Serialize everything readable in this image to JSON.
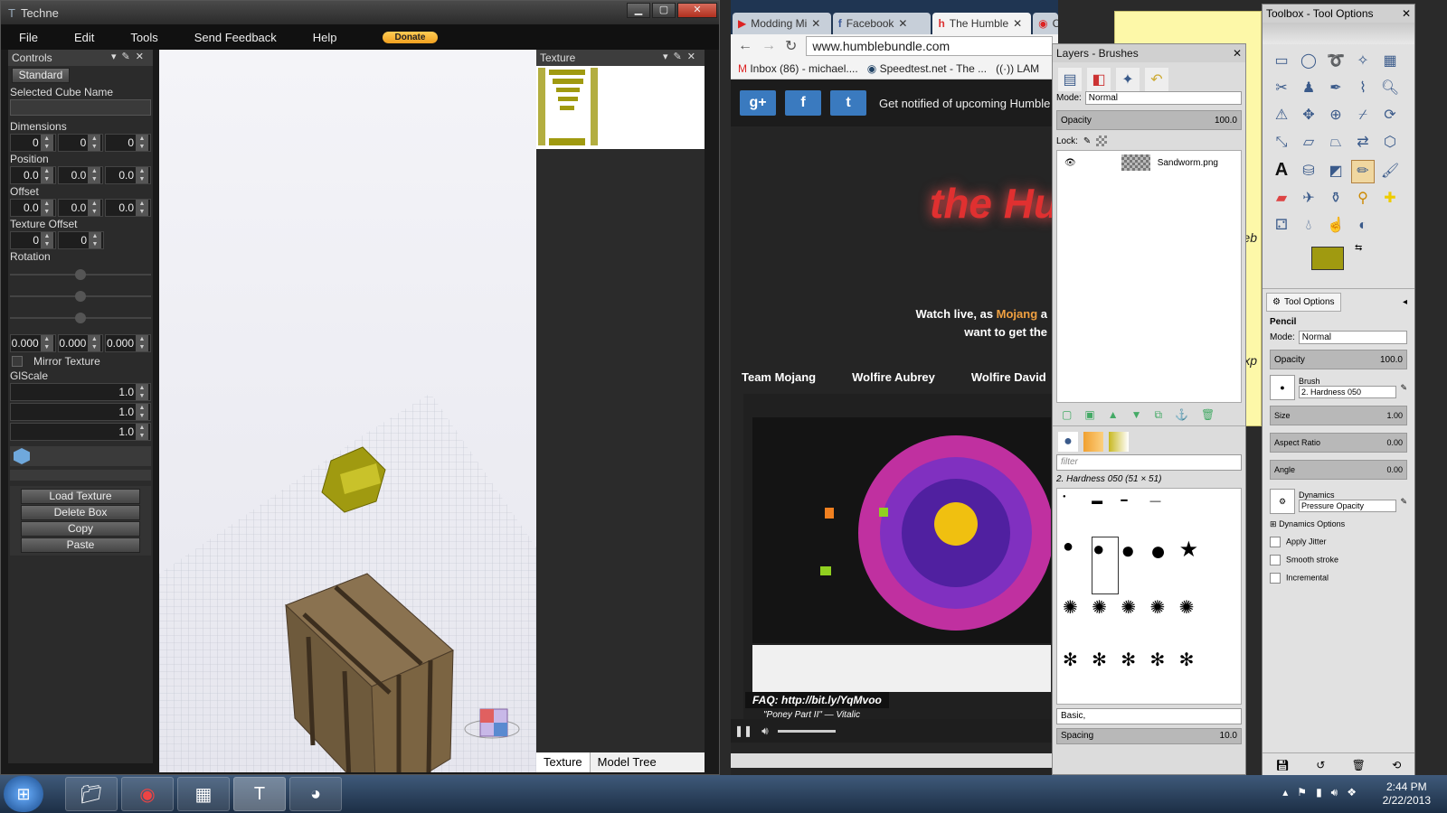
{
  "techne": {
    "title": "Techne",
    "menu": [
      "File",
      "Edit",
      "Tools",
      "Send Feedback",
      "Help"
    ],
    "donate": "Donate",
    "controls": {
      "header": "Controls",
      "standard_btn": "Standard",
      "selected_cube_label": "Selected Cube Name",
      "dimensions_label": "Dimensions",
      "dimensions": [
        "0",
        "0",
        "0"
      ],
      "position_label": "Position",
      "position": [
        "0.0",
        "0.0",
        "0.0"
      ],
      "offset_label": "Offset",
      "offset": [
        "0.0",
        "0.0",
        "0.0"
      ],
      "texture_offset_label": "Texture Offset",
      "texture_offset": [
        "0",
        "0"
      ],
      "rotation_label": "Rotation",
      "rotation": [
        "0.000",
        "0.000",
        "0.000"
      ],
      "mirror_label": "Mirror Texture",
      "glscale_label": "GlScale",
      "glscale": [
        "1.0",
        "1.0",
        "1.0"
      ],
      "load_texture": "Load Texture",
      "delete_box": "Delete Box",
      "copy": "Copy",
      "paste": "Paste"
    },
    "texture_panel": {
      "header": "Texture",
      "tab_texture": "Texture",
      "tab_model_tree": "Model Tree"
    }
  },
  "chrome": {
    "tabs": [
      "Modding Mi",
      "Facebook",
      "The Humble",
      "C"
    ],
    "url": "www.humblebundle.com",
    "bookmarks": [
      "Inbox (86) - michael....",
      "Speedtest.net - The ...",
      "LAM"
    ],
    "banner_text": "Get notified of upcoming Humble B",
    "logo": "the Hum",
    "watch_live_pre": "Watch live, as ",
    "watch_live_mojang": "Mojang",
    "watch_live_post": " a",
    "want_line": "want to get the",
    "teams": [
      "Team Mojang",
      "Wolfire Aubrey",
      "Wolfire David"
    ],
    "faq": "FAQ: http://bit.ly/YqMvoo",
    "song": "\"Poney Part II\" — Vitalic"
  },
  "layers": {
    "title": "Layers - Brushes",
    "mode_label": "Mode:",
    "mode": "Normal",
    "opacity_label": "Opacity",
    "opacity": "100.0",
    "lock_label": "Lock:",
    "layer_name": "Sandworm.png",
    "filter": "filter",
    "brush_info": "2. Hardness 050 (51 × 51)",
    "brush_set": "Basic,",
    "spacing_label": "Spacing",
    "spacing": "10.0"
  },
  "toolbox": {
    "title": "Toolbox - Tool Options",
    "fg_color": "#a09a10",
    "tool_options_tab": "Tool Options",
    "tool": "Pencil",
    "mode_label": "Mode:",
    "mode": "Normal",
    "opacity_label": "Opacity",
    "opacity": "100.0",
    "brush_label": "Brush",
    "brush": "2. Hardness 050",
    "size_label": "Size",
    "size": "1.00",
    "aspect_label": "Aspect Ratio",
    "aspect": "0.00",
    "angle_label": "Angle",
    "angle": "0.00",
    "dynamics_label": "Dynamics",
    "dynamics": "Pressure Opacity",
    "dynamics_options": "Dynamics Options",
    "apply_jitter": "Apply Jitter",
    "smooth_stroke": "Smooth stroke",
    "incremental": "Incremental"
  },
  "sticky": {
    "line1": "eb",
    "line2": "xp"
  },
  "clock": {
    "time": "2:44 PM",
    "date": "2/22/2013"
  }
}
